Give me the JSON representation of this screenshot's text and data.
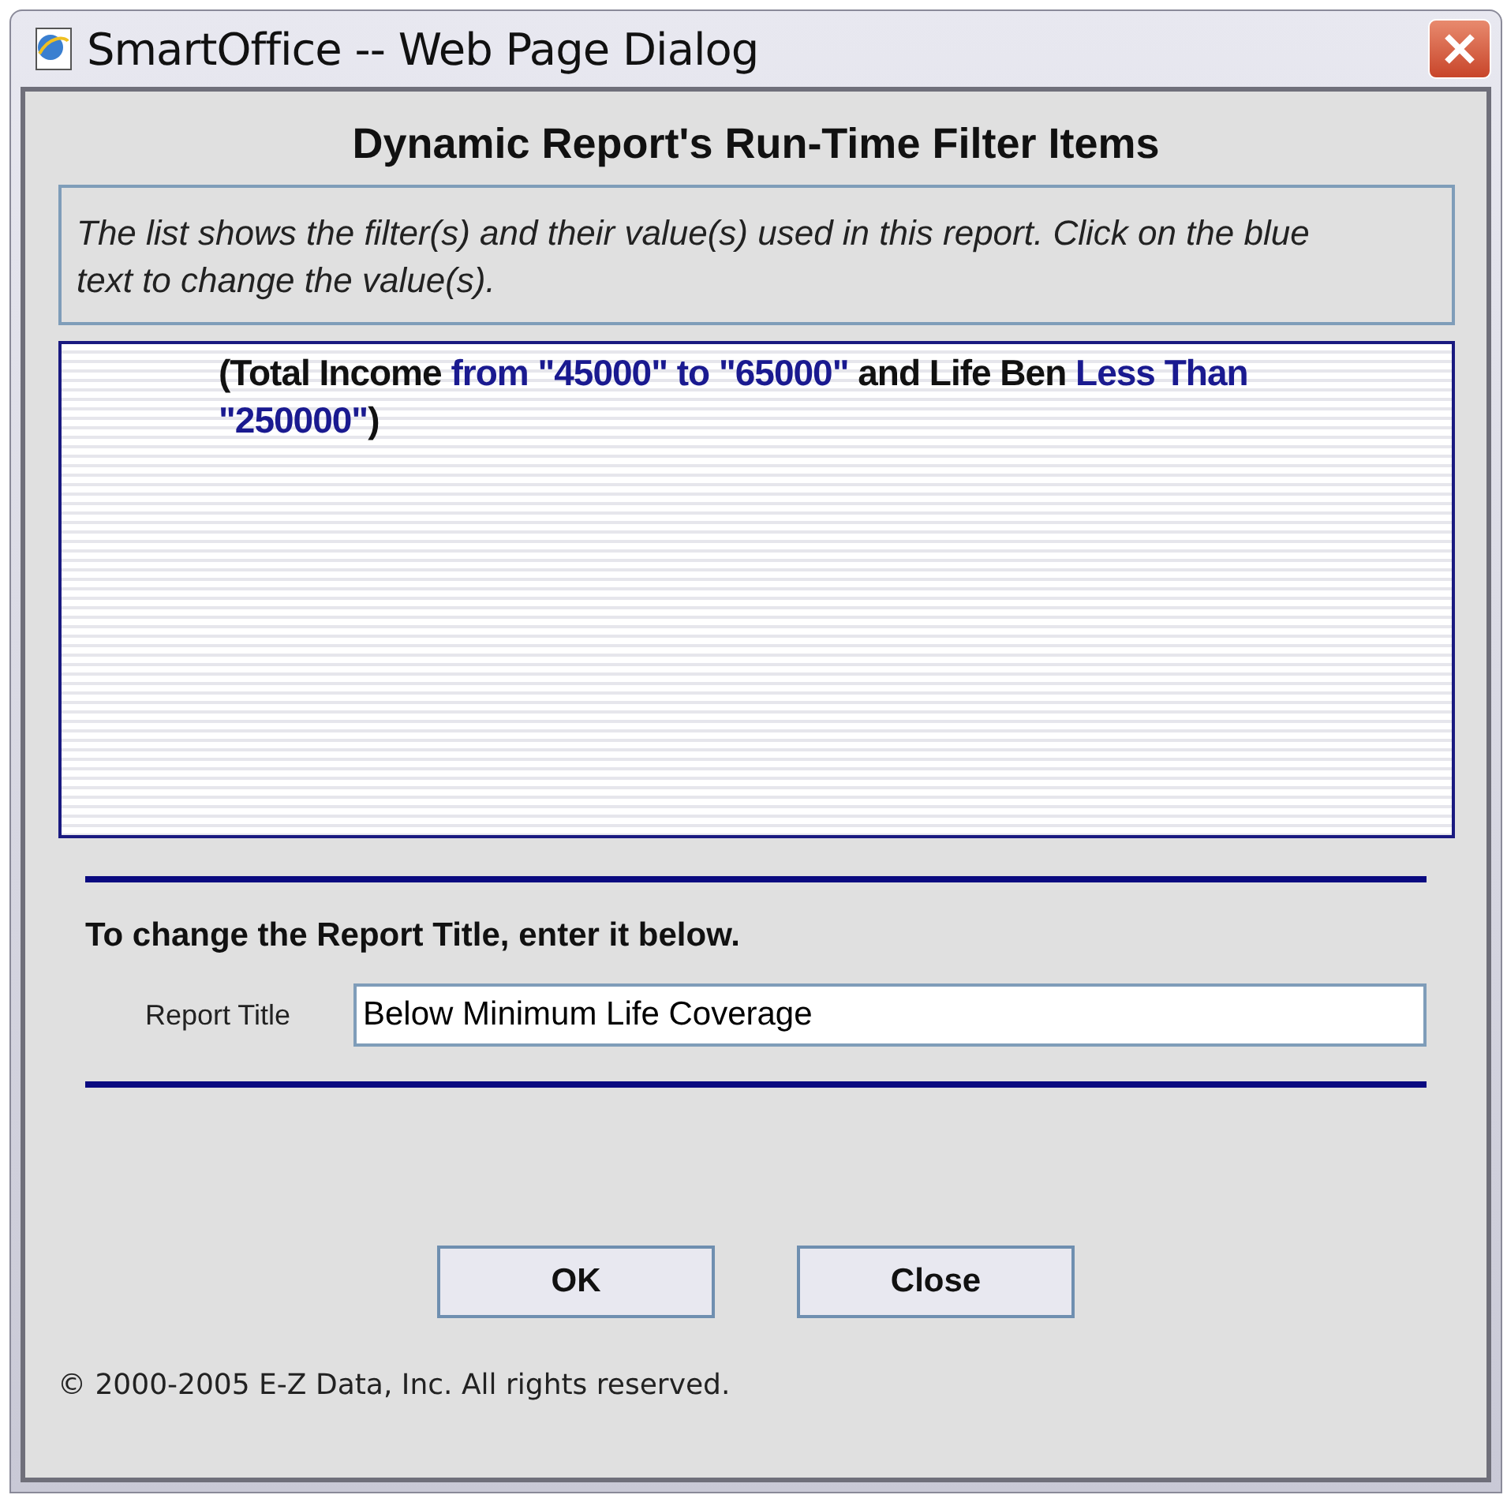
{
  "window": {
    "title": "SmartOffice -- Web Page Dialog"
  },
  "heading": "Dynamic Report's Run-Time Filter Items",
  "instructions": "The list shows the filter(s) and their value(s) used in this report. Click on the blue text to change the value(s).",
  "filter": [
    {
      "kind": "text",
      "text": "(Total Income "
    },
    {
      "kind": "link",
      "text": "from \"45000\"  to \"65000\""
    },
    {
      "kind": "text",
      "text": " and Life Ben "
    },
    {
      "kind": "link",
      "text": "Less Than"
    },
    {
      "kind": "link",
      "text": "\"250000\""
    },
    {
      "kind": "text",
      "text": ")"
    }
  ],
  "title_prompt": "To change the Report Title, enter it below.",
  "report_title": {
    "label": "Report Title",
    "value": "Below Minimum Life Coverage"
  },
  "buttons": [
    "OK",
    "Close"
  ],
  "copyright": "© 2000-2005 E-Z Data, Inc. All rights reserved."
}
